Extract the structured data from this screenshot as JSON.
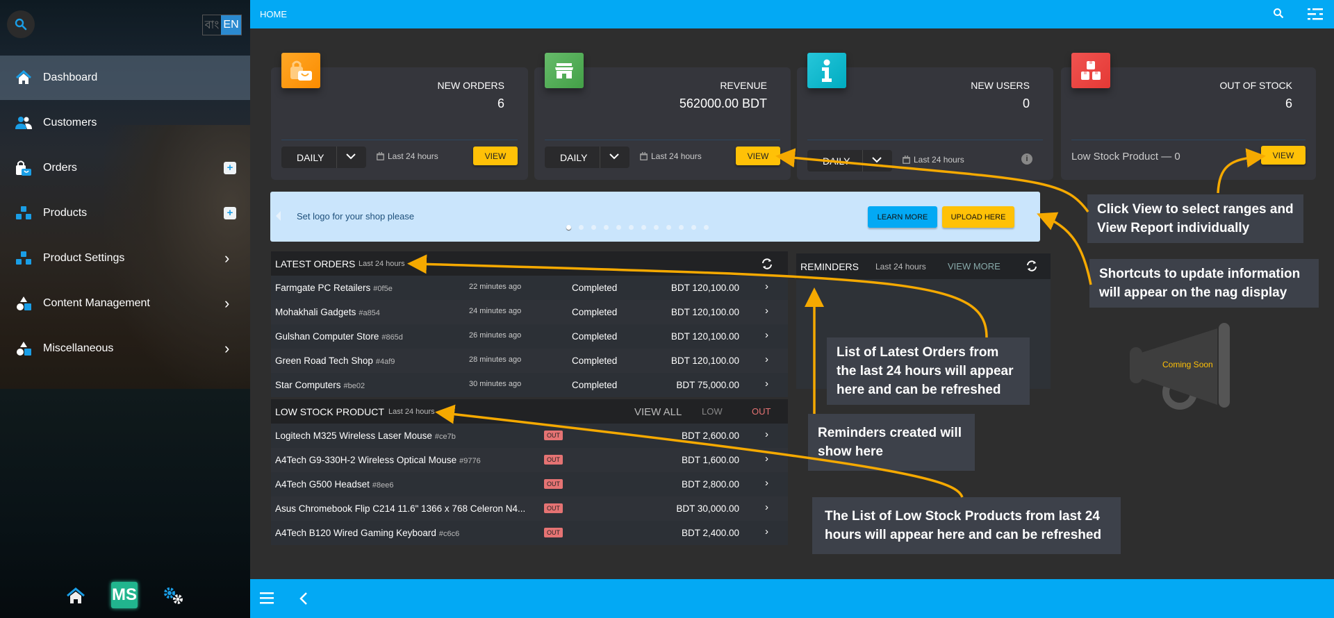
{
  "sidebar": {
    "search_icon": "search-icon",
    "lang": {
      "bn": "বাং",
      "en": "EN"
    },
    "items": [
      {
        "label": "Dashboard",
        "icon": "home-icon",
        "active": true
      },
      {
        "label": "Customers",
        "icon": "users-icon"
      },
      {
        "label": "Orders",
        "icon": "shopping-bag-icon",
        "action": "plus"
      },
      {
        "label": "Products",
        "icon": "boxes-icon",
        "action": "plus"
      },
      {
        "label": "Product Settings",
        "icon": "boxes-icon",
        "action": "chevron"
      },
      {
        "label": "Content Management",
        "icon": "shapes-icon",
        "action": "chevron"
      },
      {
        "label": "Miscellaneous",
        "icon": "shapes-icon",
        "action": "chevron"
      }
    ],
    "bottom": {
      "home": "home-icon",
      "logo": "MS",
      "settings": "gears-icon"
    }
  },
  "topbar": {
    "title": "HOME",
    "icons": [
      "search-icon",
      "filter-icon"
    ]
  },
  "cards": [
    {
      "title": "NEW ORDERS",
      "value": "6",
      "range": "DAILY",
      "period": "Last 24 hours",
      "view": "VIEW",
      "color": "#ff9800"
    },
    {
      "title": "REVENUE",
      "value": "562000.00 BDT",
      "range": "DAILY",
      "period": "Last 24 hours",
      "view": "VIEW",
      "color": "#4caf50"
    },
    {
      "title": "NEW USERS",
      "value": "0",
      "range": "DAILY",
      "period": "Last 24 hours",
      "info": "i",
      "color": "#00acc1"
    },
    {
      "title": "OUT OF STOCK",
      "value": "6",
      "low": "Low Stock Product — 0",
      "view": "VIEW",
      "color": "#e53935"
    }
  ],
  "banner": {
    "text": "Set logo for your shop please",
    "learn": "LEARN MORE",
    "upload": "UPLOAD HERE",
    "dots": 12,
    "active_dot": 1
  },
  "latest_orders": {
    "title": "LATEST ORDERS",
    "subtitle": "Last 24 hours",
    "rows": [
      {
        "name": "Farmgate PC Retailers",
        "code": "#0f5e",
        "time": "22 minutes ago",
        "status": "Completed",
        "amount": "BDT 120,100.00"
      },
      {
        "name": "Mohakhali Gadgets",
        "code": "#a854",
        "time": "24 minutes ago",
        "status": "Completed",
        "amount": "BDT 120,100.00"
      },
      {
        "name": "Gulshan Computer Store",
        "code": "#865d",
        "time": "26 minutes ago",
        "status": "Completed",
        "amount": "BDT 120,100.00"
      },
      {
        "name": "Green Road Tech Shop",
        "code": "#4af9",
        "time": "28 minutes ago",
        "status": "Completed",
        "amount": "BDT 120,100.00"
      },
      {
        "name": "Star Computers",
        "code": "#be02",
        "time": "30 minutes ago",
        "status": "Completed",
        "amount": "BDT 75,000.00"
      }
    ]
  },
  "low_stock": {
    "title": "LOW STOCK PRODUCT",
    "subtitle": "Last 24 hours",
    "view_all": "VIEW ALL",
    "low": "LOW",
    "out": "OUT",
    "rows": [
      {
        "name": "Logitech M325 Wireless Laser Mouse",
        "code": "#ce7b",
        "badge": "OUT",
        "amount": "BDT 2,600.00"
      },
      {
        "name": "A4Tech G9-330H-2 Wireless Optical Mouse",
        "code": "#9776",
        "badge": "OUT",
        "amount": "BDT 1,600.00"
      },
      {
        "name": "A4Tech G500 Headset",
        "code": "#8ee6",
        "badge": "OUT",
        "amount": "BDT 2,800.00"
      },
      {
        "name": "Asus Chromebook Flip C214 11.6\" 1366 x 768 Celeron N4...",
        "code": "",
        "badge": "OUT",
        "amount": "BDT 30,000.00"
      },
      {
        "name": "A4Tech B120 Wired Gaming Keyboard",
        "code": "#c6c6",
        "badge": "OUT",
        "amount": "BDT 2,400.00"
      }
    ]
  },
  "reminders": {
    "title": "REMINDERS",
    "subtitle": "Last 24 hours",
    "view_more": "VIEW MORE"
  },
  "coming_soon": "Coming Soon",
  "annotations": {
    "view": "Click View to select ranges and View Report individually",
    "shortcuts": "Shortcuts to update information will appear on the nag display",
    "latest": "List of Latest Orders from the last 24 hours will appear here and can be refreshed",
    "reminders": "Reminders created will show here",
    "lowstock": "The List of Low Stock Products from last 24 hours will appear here and can be refreshed"
  },
  "colors": {
    "accent": "#03a9f4",
    "view": "#ffc107",
    "annotation_arrow": "#f5a900"
  }
}
